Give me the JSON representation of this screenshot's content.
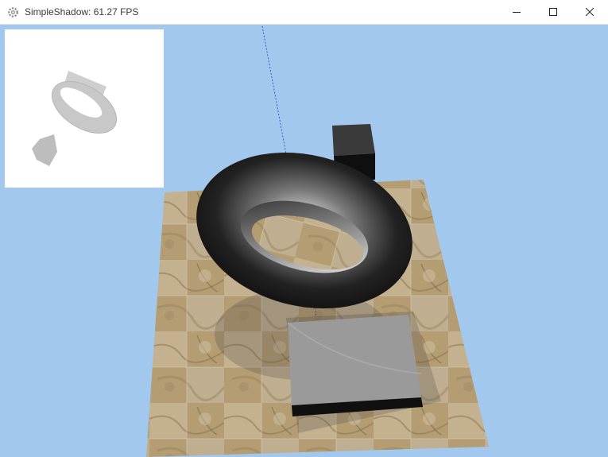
{
  "window": {
    "title": "SimpleShadow: 61.27 FPS",
    "app_icon": "gear-icon",
    "controls": {
      "minimize_icon": "minimize-icon",
      "maximize_icon": "maximize-icon",
      "close_icon": "close-icon"
    }
  },
  "colors": {
    "sky": "#a3c8ee",
    "torus": "#1e1e1e",
    "box_top": "#9a9a9a",
    "floor": "#b09a72",
    "shadowmap_bg": "#ffffff",
    "shadow_shapes": "#bfbfbf"
  }
}
